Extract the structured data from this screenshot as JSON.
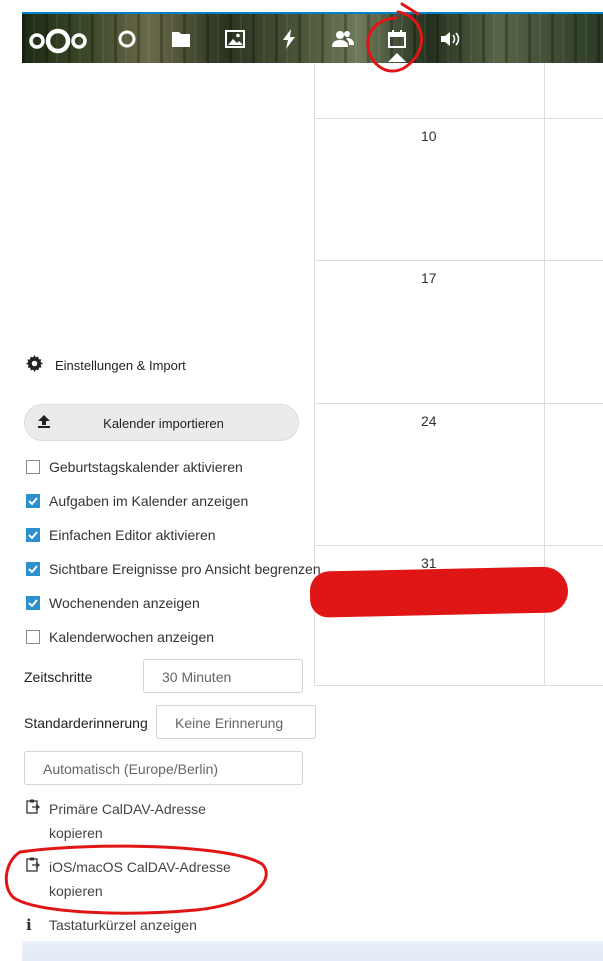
{
  "top_nav": {
    "brand": "nextcloud-logo",
    "icons": [
      "dashboard-icon",
      "files-icon",
      "photos-icon",
      "activity-icon",
      "contacts-icon",
      "calendar-icon",
      "audio-icon"
    ],
    "active": "calendar-icon",
    "accent_color": "#0082c9"
  },
  "calendar": {
    "day_numbers": [
      "10",
      "17",
      "24",
      "31"
    ]
  },
  "settings_panel": {
    "header_label": "Einstellungen & Import",
    "import_button_label": "Kalender importieren",
    "checkboxes": [
      {
        "label": "Geburtstagskalender aktivieren",
        "checked": false
      },
      {
        "label": "Aufgaben im Kalender anzeigen",
        "checked": true
      },
      {
        "label": "Einfachen Editor aktivieren",
        "checked": true
      },
      {
        "label": "Sichtbare Ereignisse pro Ansicht begrenzen",
        "checked": true
      },
      {
        "label": "Wochenenden anzeigen",
        "checked": true
      },
      {
        "label": "Kalenderwochen anzeigen",
        "checked": false
      }
    ],
    "time_steps_label": "Zeitschritte",
    "time_steps_value": "30 Minuten",
    "default_reminder_label": "Standarderinnerung",
    "default_reminder_value": "Keine Erinnerung",
    "timezone_value": "Automatisch (Europe/Berlin)",
    "links": [
      {
        "line1": "Primäre CalDAV-Adresse",
        "line2": "kopieren",
        "icon": "clipboard-icon"
      },
      {
        "line1": "iOS/macOS CalDAV-Adresse",
        "line2": "kopieren",
        "icon": "clipboard-icon"
      },
      {
        "line1": "Tastaturkürzel anzeigen",
        "icon": "info-icon"
      }
    ],
    "checkbox_color": "#2b8fd0"
  },
  "annotation_color": "#e01616"
}
